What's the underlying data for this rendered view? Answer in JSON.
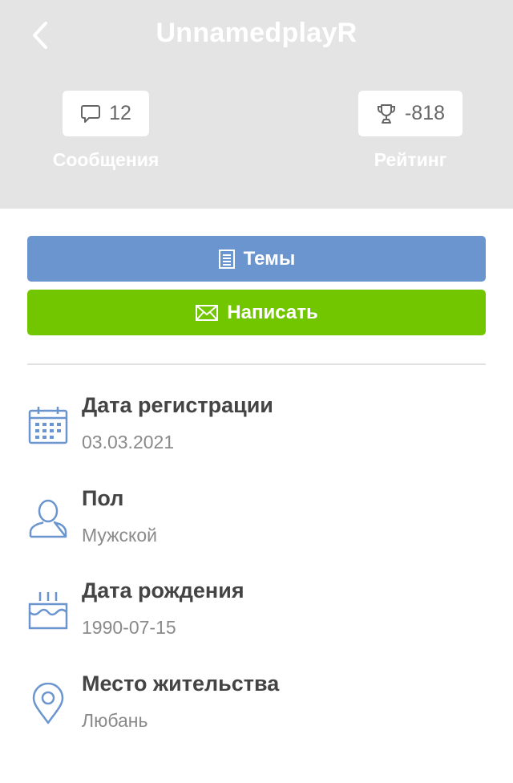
{
  "header": {
    "title": "UnnamedplayR",
    "stats": {
      "messages": {
        "count": "12",
        "label": "Сообщения"
      },
      "rating": {
        "value": "-818",
        "label": "Рейтинг"
      }
    }
  },
  "actions": {
    "topics_label": "Темы",
    "write_label": "Написать"
  },
  "info": {
    "registration": {
      "label": "Дата регистрации",
      "value": "03.03.2021"
    },
    "gender": {
      "label": "Пол",
      "value": "Мужской"
    },
    "birth": {
      "label": "Дата рождения",
      "value": "1990-07-15"
    },
    "city": {
      "label": "Место жительства",
      "value": "Любань"
    }
  },
  "colors": {
    "header_bg": "#e4e4e4",
    "topics_button": "#6a95cf",
    "write_button": "#72c600",
    "icon_blue": "#6a95cf",
    "label_text": "#444444",
    "value_text": "#8a8a8a"
  },
  "icons": {
    "back": "chevron-left-icon",
    "messages": "speech-bubble-icon",
    "rating": "trophy-icon",
    "topics": "document-icon",
    "write": "envelope-icon",
    "registration": "calendar-icon",
    "gender": "user-icon",
    "birth": "birthday-cake-icon",
    "city": "map-pin-icon"
  }
}
